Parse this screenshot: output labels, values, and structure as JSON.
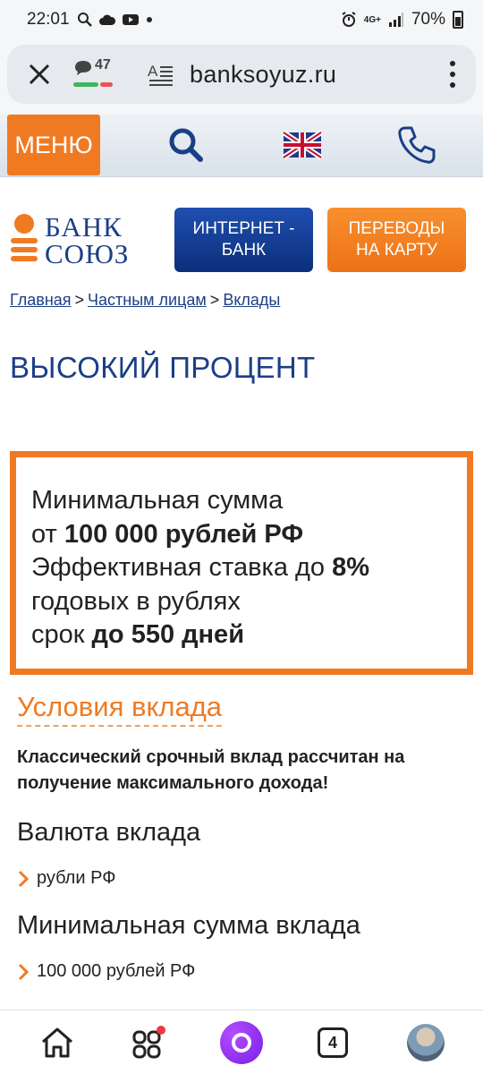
{
  "status_bar": {
    "time": "22:01",
    "network": "4G+",
    "battery": "70%"
  },
  "browser": {
    "comments_count": "47",
    "url": "banksoyuz.ru"
  },
  "site_nav": {
    "menu_label": "МЕНЮ"
  },
  "header": {
    "logo_word1": "БАНК",
    "logo_word2": "СОЮЗ",
    "internet_bank_label": "ИНТЕРНЕТ - БАНК",
    "transfers_label": "ПЕРЕВОДЫ НА КАРТУ"
  },
  "breadcrumb": {
    "items": [
      "Главная",
      "Частным лицам",
      "Вклады"
    ],
    "separator": ">"
  },
  "page": {
    "title": "ВЫСОКИЙ ПРОЦЕНТ"
  },
  "promo": {
    "line1": "Минимальная сумма",
    "line2_prefix": "от ",
    "line2_bold": "100 000 рублей РФ",
    "line3_prefix": "Эффективная ставка до ",
    "line3_bold": "8%",
    "line4": "годовых в рублях",
    "line5_prefix": "срок ",
    "line5_bold": "до 550 дней"
  },
  "conditions": {
    "heading": "Условия вклада",
    "lead": "Классический срочный вклад рассчитан на получение максимального дохода!",
    "sections": [
      {
        "title": "Валюта вклада",
        "value": "рубли РФ"
      },
      {
        "title": "Минимальная сумма вклада",
        "value": "100 000 рублей РФ"
      }
    ]
  },
  "bottom_nav": {
    "tabs_count": "4"
  },
  "colors": {
    "accent_orange": "#f07a22",
    "brand_blue": "#1b3f86"
  }
}
